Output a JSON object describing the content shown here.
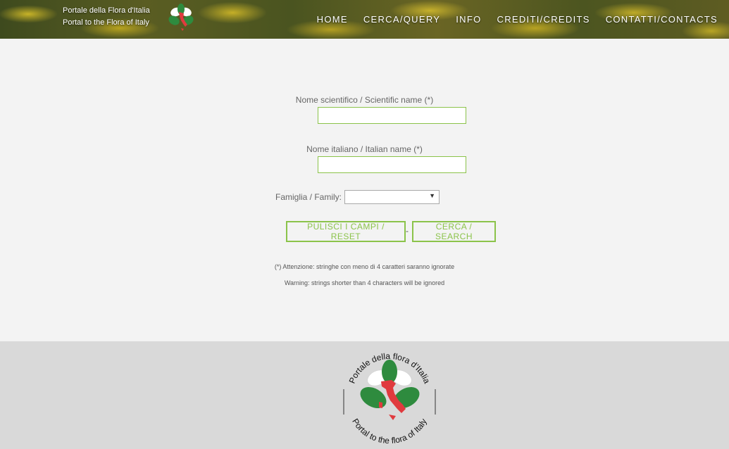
{
  "header": {
    "brand_line1": "Portale della Flora d'Italia",
    "brand_line2": "Portal to the Flora of Italy",
    "nav": [
      "HOME",
      "CERCA/QUERY",
      "INFO",
      "CREDITI/CREDITS",
      "CONTATTI/CONTACTS"
    ]
  },
  "form": {
    "scientific_label": "Nome scientifico / Scientific name (*)",
    "scientific_value": "",
    "italian_label": "Nome italiano / Italian name (*)",
    "italian_value": "",
    "family_label": "Famiglia / Family:",
    "family_selected": "",
    "reset_label": "PULISCI I CAMPI / RESET",
    "separator": "-",
    "search_label": "CERCA / SEARCH",
    "note_it": "(*) Attenzione: stringhe con meno di 4 caratteri saranno ignorate",
    "note_en": "Warning: strings shorter than 4 characters will be ignored"
  },
  "footer": {
    "logo_text_top": "Portale della flora d'Italia",
    "logo_text_bottom": "Portal to the flora of Italy"
  },
  "colors": {
    "accent": "#8bc34a",
    "leaf_green": "#2e8b3e",
    "italy_red": "#e03a3e",
    "footer_bg": "#d9d9d9",
    "page_bg": "#f3f3f3"
  },
  "icons": {
    "header_logo": "flora-italy-logo-icon",
    "select_arrow": "chevron-down-icon"
  }
}
